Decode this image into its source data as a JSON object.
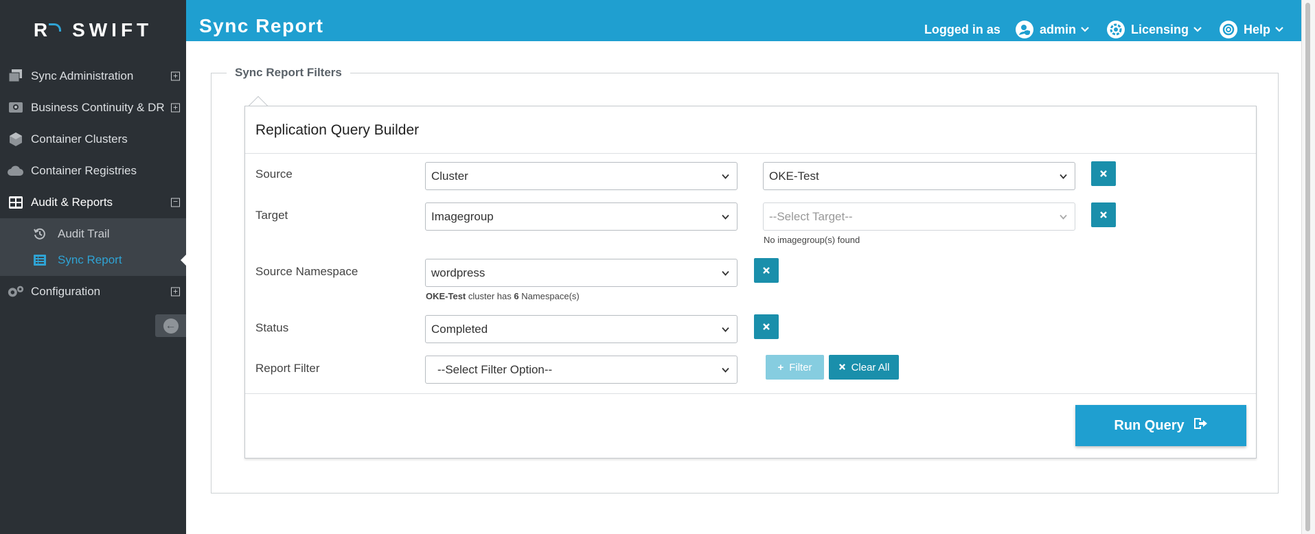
{
  "brand": {
    "logo_r": "R",
    "logo_text": "SWIFT"
  },
  "header": {
    "title": "Sync Report",
    "logged_in_label": "Logged in as",
    "user": "admin",
    "licensing": "Licensing",
    "help": "Help"
  },
  "sidebar": {
    "items": [
      {
        "label": "Sync Administration"
      },
      {
        "label": "Business Continuity & DR"
      },
      {
        "label": "Container Clusters"
      },
      {
        "label": "Container Registries"
      },
      {
        "label": "Audit & Reports"
      },
      {
        "label": "Configuration"
      }
    ],
    "sub_items": [
      {
        "label": "Audit Trail"
      },
      {
        "label": "Sync Report"
      }
    ]
  },
  "filters": {
    "legend": "Sync Report Filters",
    "builder_title": "Replication Query Builder",
    "rows": {
      "source": {
        "label": "Source",
        "type_value": "Cluster",
        "value": "OKE-Test"
      },
      "target": {
        "label": "Target",
        "type_value": "Imagegroup",
        "placeholder": "--Select Target--",
        "hint": "No imagegroup(s) found"
      },
      "namespace": {
        "label": "Source Namespace",
        "value": "wordpress",
        "hint_cluster": "OKE-Test",
        "hint_mid": " cluster has ",
        "hint_count": "6",
        "hint_end": " Namespace(s)"
      },
      "status": {
        "label": "Status",
        "value": "Completed"
      },
      "report_filter": {
        "label": "Report Filter",
        "value": "--Select Filter Option--"
      }
    },
    "filter_button": "Filter",
    "clear_button": "Clear All",
    "run_button": "Run Query"
  },
  "colors": {
    "header": "#1f9fd0",
    "sidebar": "#2b3035",
    "accent": "#2fa3d4",
    "button": "#1a8fab"
  }
}
